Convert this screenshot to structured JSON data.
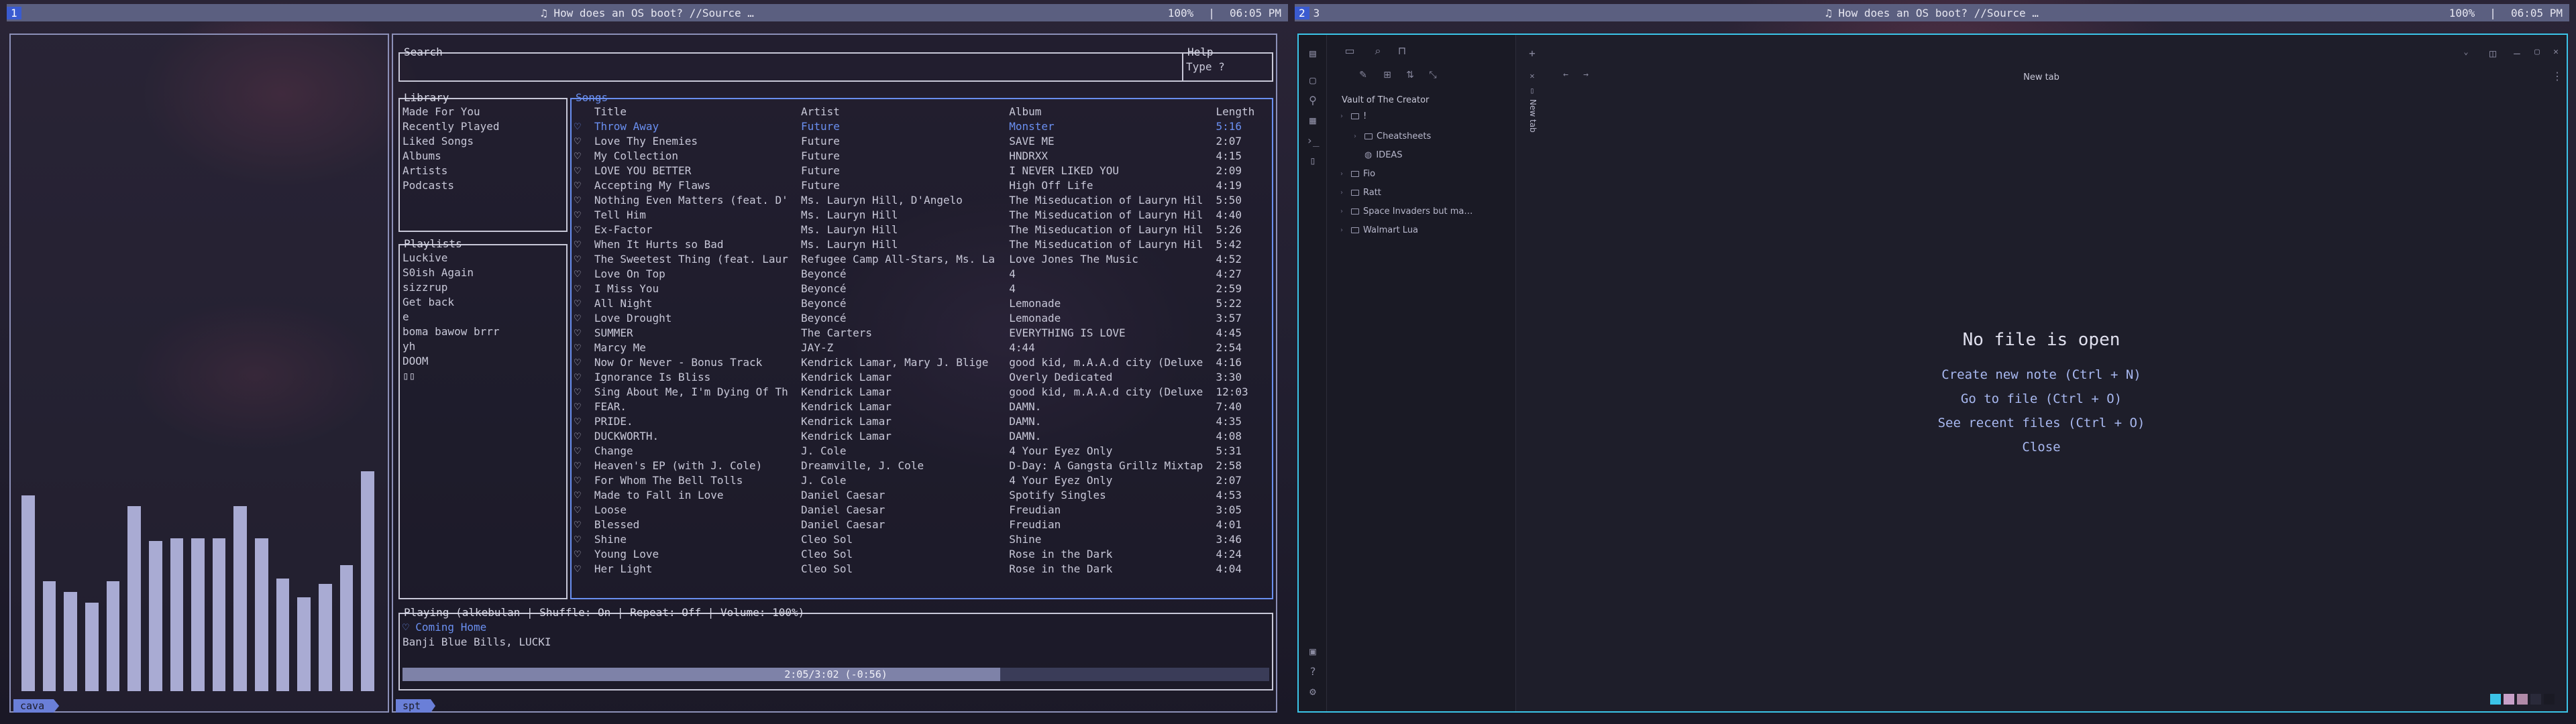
{
  "top_bar_left": {
    "workspace": "1",
    "title": "♫ How does an OS boot? //Source …",
    "volume": "100%",
    "time": "06:05 PM"
  },
  "top_bar_right": {
    "workspaces": [
      "2",
      "3"
    ],
    "title": "♫ How does an OS boot? //Source …",
    "volume": "100%",
    "time": "06:05 PM"
  },
  "cava": {
    "tag": "cava",
    "bar_levels": [
      0.73,
      0.41,
      0.37,
      0.33,
      0.41,
      0.69,
      0.56,
      0.57,
      0.57,
      0.57,
      0.69,
      0.57,
      0.42,
      0.35,
      0.4,
      0.47,
      0.82
    ],
    "bar_color": "#a9abd3"
  },
  "spt": {
    "tag": "spt",
    "search": {
      "label": "Search",
      "value": ""
    },
    "help": {
      "label": "Help",
      "text": "Type ?"
    },
    "library": {
      "label": "Library",
      "items": [
        "Made For You",
        "Recently Played",
        "Liked Songs",
        "Albums",
        "Artists",
        "Podcasts"
      ]
    },
    "playlists": {
      "label": "Playlists",
      "items": [
        "Luckive",
        "S0ish Again",
        "sizzrup",
        "Get back",
        "e",
        "boma bawow brrr",
        "yh",
        "DOOM",
        "▯▯"
      ]
    },
    "songs": {
      "label": "Songs",
      "headers": [
        "",
        "Title",
        "Artist",
        "Album",
        "Length"
      ],
      "rows": [
        [
          "♡",
          "Throw Away",
          "Future",
          "Monster",
          "5:16"
        ],
        [
          "♡",
          "Love Thy Enemies",
          "Future",
          "SAVE ME",
          "2:07"
        ],
        [
          "♡",
          "My Collection",
          "Future",
          "HNDRXX",
          "4:15"
        ],
        [
          "♡",
          "LOVE YOU BETTER",
          "Future",
          "I NEVER LIKED YOU",
          "2:09"
        ],
        [
          "♡",
          "Accepting My Flaws",
          "Future",
          "High Off Life",
          "4:19"
        ],
        [
          "♡",
          "Nothing Even Matters (feat. D'",
          "Ms. Lauryn Hill, D'Angelo",
          "The Miseducation of Lauryn Hil",
          "5:50"
        ],
        [
          "♡",
          "Tell Him",
          "Ms. Lauryn Hill",
          "The Miseducation of Lauryn Hil",
          "4:40"
        ],
        [
          "♡",
          "Ex-Factor",
          "Ms. Lauryn Hill",
          "The Miseducation of Lauryn Hil",
          "5:26"
        ],
        [
          "♡",
          "When It Hurts so Bad",
          "Ms. Lauryn Hill",
          "The Miseducation of Lauryn Hil",
          "5:42"
        ],
        [
          "♡",
          "The Sweetest Thing (feat. Laur",
          "Refugee Camp All-Stars, Ms. La",
          "Love Jones The Music",
          "4:52"
        ],
        [
          "♡",
          "Love On Top",
          "Beyoncé",
          "4",
          "4:27"
        ],
        [
          "♡",
          "I Miss You",
          "Beyoncé",
          "4",
          "2:59"
        ],
        [
          "♡",
          "All Night",
          "Beyoncé",
          "Lemonade",
          "5:22"
        ],
        [
          "♡",
          "Love Drought",
          "Beyoncé",
          "Lemonade",
          "3:57"
        ],
        [
          "♡",
          "SUMMER",
          "The Carters",
          "EVERYTHING IS LOVE",
          "4:45"
        ],
        [
          "♡",
          "Marcy Me",
          "JAY-Z",
          "4:44",
          "2:54"
        ],
        [
          "♡",
          "Now Or Never - Bonus Track",
          "Kendrick Lamar, Mary J. Blige",
          "good kid, m.A.A.d city (Deluxe",
          "4:16"
        ],
        [
          "♡",
          "Ignorance Is Bliss",
          "Kendrick Lamar",
          "Overly Dedicated",
          "3:30"
        ],
        [
          "♡",
          "Sing About Me, I'm Dying Of Th",
          "Kendrick Lamar",
          "good kid, m.A.A.d city (Deluxe",
          "12:03"
        ],
        [
          "♡",
          "FEAR.",
          "Kendrick Lamar",
          "DAMN.",
          "7:40"
        ],
        [
          "♡",
          "PRIDE.",
          "Kendrick Lamar",
          "DAMN.",
          "4:35"
        ],
        [
          "♡",
          "DUCKWORTH.",
          "Kendrick Lamar",
          "DAMN.",
          "4:08"
        ],
        [
          "♡",
          "Change",
          "J. Cole",
          "4 Your Eyez Only",
          "5:31"
        ],
        [
          "♡",
          "Heaven's EP (with J. Cole)",
          "Dreamville, J. Cole",
          "D-Day: A Gangsta Grillz Mixtap",
          "2:58"
        ],
        [
          "♡",
          "For Whom The Bell Tolls",
          "J. Cole",
          "4 Your Eyez Only",
          "2:07"
        ],
        [
          "♡",
          "Made to Fall in Love",
          "Daniel Caesar",
          "Spotify Singles",
          "4:53"
        ],
        [
          "♡",
          "Loose",
          "Daniel Caesar",
          "Freudian",
          "3:05"
        ],
        [
          "♡",
          "Blessed",
          "Daniel Caesar",
          "Freudian",
          "4:01"
        ],
        [
          "♡",
          "Shine",
          "Cleo Sol",
          "Shine",
          "3:46"
        ],
        [
          "♡",
          "Young Love",
          "Cleo Sol",
          "Rose in the Dark",
          "4:24"
        ],
        [
          "♡",
          "Her Light",
          "Cleo Sol",
          "Rose in the Dark",
          "4:04"
        ]
      ]
    },
    "playing": {
      "label": "Playing (alkebulan | Shuffle: On  | Repeat: Off  | Volume: 100%)",
      "track": "♡ Coming Home",
      "artists": "Banji Blue Bills, LUCKI",
      "progress_text": "2:05/3:02 (-0:56)",
      "progress": 0.69
    }
  },
  "obsidian": {
    "vault_name": "Vault of The Creator",
    "tab_title": "New tab",
    "side_tab": "New tab",
    "tree": [
      {
        "label": "!",
        "type": "folder"
      },
      {
        "label": "Cheatsheets",
        "type": "folder"
      },
      {
        "label": "IDEAS",
        "type": "note"
      },
      {
        "label": "Fio",
        "type": "folder"
      },
      {
        "label": "Ratt",
        "type": "folder"
      },
      {
        "label": "Space Invaders but ma…",
        "type": "folder"
      },
      {
        "label": "Walmart Lua",
        "type": "folder"
      }
    ],
    "empty": {
      "heading": "No file is open",
      "create": "Create new note (Ctrl + N)",
      "goto": "Go to file (Ctrl + O)",
      "recent": "See recent files (Ctrl + O)",
      "close": "Close"
    },
    "swatch_colors": [
      "#3bc4e8",
      "#c8a0c8",
      "#b08aa8",
      "#2a2a3a",
      "#1a1a24"
    ]
  }
}
